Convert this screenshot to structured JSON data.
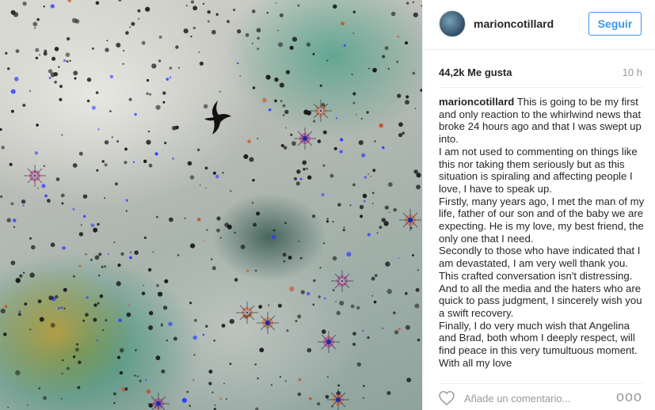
{
  "post": {
    "username": "marioncotillard",
    "follow_label": "Seguir",
    "likes": "44,2k Me gusta",
    "time_ago": "10 h",
    "caption": {
      "username": "marioncotillard",
      "lines": [
        "This is going to be my first and only reaction to the whirlwind news that broke 24 hours ago and that I was swept up into.",
        "I am not used to commenting on things like this nor taking them seriously but as this situation is spiraling and affecting people I love, I have to speak up.",
        "Firstly, many years ago, I met the man of my life, father of our son and of the baby we are expecting. He is my love, my best friend, the only one that I need.",
        "Secondly to those who have indicated that I am devastated, I am very well thank you. This crafted conversation isn't distressing. And to all the media and the haters who are quick to pass judgment, I sincerely wish you a swift recovery.",
        "Finally, I do very much wish that Angelina and Brad, both whom I deeply respect, will find peace in this very tumultuous moment. With all my love"
      ]
    },
    "comment_placeholder": "Añade un comentario...",
    "more_glyph": "ooo"
  },
  "icons": {
    "avatar": "avatar-image",
    "like": "heart-icon",
    "more": "more-options-icon",
    "photo_subject": "bird-silhouette"
  },
  "colors": {
    "accent": "#3897f0",
    "muted": "#999999",
    "divider": "#efefef"
  }
}
